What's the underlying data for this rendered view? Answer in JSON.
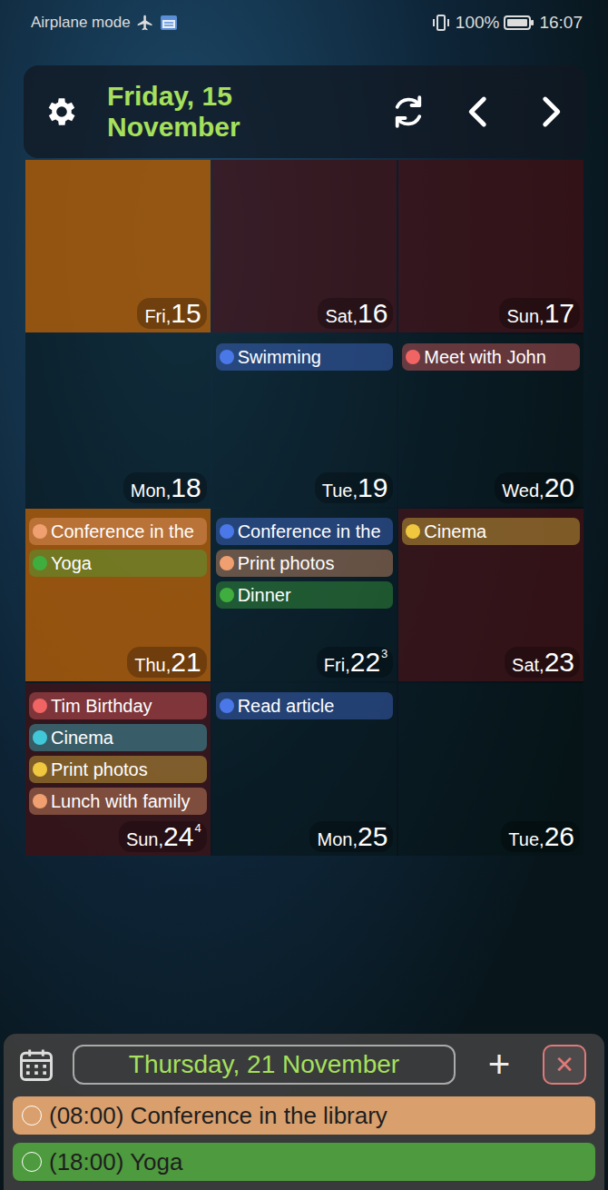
{
  "status_bar": {
    "left_text": "Airplane mode",
    "battery": "100%",
    "time": "16:07"
  },
  "header": {
    "date_line1": "Friday, 15",
    "date_line2": "November"
  },
  "calendar": {
    "days": [
      {
        "weekday": "Fri,",
        "day": "15",
        "badge": "",
        "kind": "weekday",
        "today": true,
        "selected": false,
        "events": []
      },
      {
        "weekday": "Sat,",
        "day": "16",
        "badge": "",
        "kind": "weekend",
        "today": false,
        "selected": false,
        "events": []
      },
      {
        "weekday": "Sun,",
        "day": "17",
        "badge": "",
        "kind": "weekend",
        "today": false,
        "selected": false,
        "events": []
      },
      {
        "weekday": "Mon,",
        "day": "18",
        "badge": "",
        "kind": "weekday",
        "today": false,
        "selected": false,
        "events": []
      },
      {
        "weekday": "Tue,",
        "day": "19",
        "badge": "",
        "kind": "weekday",
        "today": false,
        "selected": false,
        "events": [
          {
            "title": "Swimming",
            "color": "#4a78e8"
          }
        ]
      },
      {
        "weekday": "Wed,",
        "day": "20",
        "badge": "",
        "kind": "weekday",
        "today": false,
        "selected": false,
        "events": [
          {
            "title": "Meet with John",
            "color": "#f06464"
          }
        ]
      },
      {
        "weekday": "Thu,",
        "day": "21",
        "badge": "",
        "kind": "weekday",
        "today": false,
        "selected": true,
        "events": [
          {
            "title": "Conference in the",
            "color": "#f0a070"
          },
          {
            "title": "Yoga",
            "color": "#3fae3f"
          }
        ]
      },
      {
        "weekday": "Fri,",
        "day": "22",
        "badge": "3",
        "kind": "weekday",
        "today": false,
        "selected": false,
        "events": [
          {
            "title": "Conference in the",
            "color": "#4a78e8"
          },
          {
            "title": "Print photos",
            "color": "#f0a070"
          },
          {
            "title": "Dinner",
            "color": "#3fae3f"
          }
        ]
      },
      {
        "weekday": "Sat,",
        "day": "23",
        "badge": "",
        "kind": "weekend",
        "today": false,
        "selected": false,
        "events": [
          {
            "title": "Cinema",
            "color": "#f0c840"
          }
        ]
      },
      {
        "weekday": "Sun,",
        "day": "24",
        "badge": "4",
        "kind": "weekend",
        "today": false,
        "selected": false,
        "events": [
          {
            "title": "Tim Birthday",
            "color": "#f06464"
          },
          {
            "title": "Cinema",
            "color": "#40c8d8"
          },
          {
            "title": "Print photos",
            "color": "#f0c840"
          },
          {
            "title": "Lunch with family",
            "color": "#f0a070"
          }
        ]
      },
      {
        "weekday": "Mon,",
        "day": "25",
        "badge": "",
        "kind": "weekday",
        "today": false,
        "selected": false,
        "events": [
          {
            "title": "Read article",
            "color": "#4a78e8"
          }
        ]
      },
      {
        "weekday": "Tue,",
        "day": "26",
        "badge": "",
        "kind": "weekday",
        "today": false,
        "selected": false,
        "events": []
      }
    ]
  },
  "agenda": {
    "title": "Thursday, 21 November",
    "add_label": "+",
    "close_label": "✕",
    "events": [
      {
        "time": "(08:00)",
        "title": "Conference in the library",
        "color": "#d9a06e"
      },
      {
        "time": "(18:00)",
        "title": "Yoga",
        "color": "#4e9a3e"
      }
    ]
  }
}
